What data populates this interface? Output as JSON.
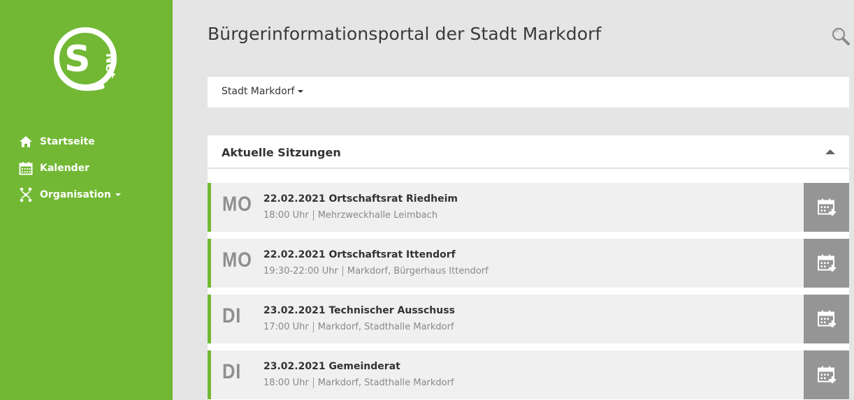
{
  "header": {
    "title": "Bürgerinformationsportal der Stadt Markdorf"
  },
  "logo": {
    "letters": "SNet"
  },
  "sidebar": {
    "items": [
      {
        "label": "Startseite",
        "icon": "home-icon"
      },
      {
        "label": "Kalender",
        "icon": "calendar-icon"
      },
      {
        "label": "Organisation",
        "icon": "organisation-icon",
        "has_dropdown": true
      }
    ]
  },
  "selector": {
    "label": "Stadt Markdorf"
  },
  "panel": {
    "title": "Aktuelle Sitzungen"
  },
  "sessions": [
    {
      "day": "MO",
      "title": "22.02.2021 Ortschaftsrat Riedheim",
      "time": "18:00 Uhr",
      "location": "Mehrzweckhalle Leimbach"
    },
    {
      "day": "MO",
      "title": "22.02.2021 Ortschaftsrat Ittendorf",
      "time": "19:30-22:00 Uhr",
      "location": "Markdorf, Bürgerhaus Ittendorf"
    },
    {
      "day": "DI",
      "title": "23.02.2021 Technischer Ausschuss",
      "time": "17:00 Uhr",
      "location": "Markdorf, Stadthalle Markdorf"
    },
    {
      "day": "DI",
      "title": "23.02.2021 Gemeinderat",
      "time": "18:00 Uhr",
      "location": "Markdorf, Stadthalle Markdorf"
    }
  ],
  "colors": {
    "accent": "#72b834",
    "background": "#e5e5e5",
    "row_bg": "#f0f0f0",
    "day_text": "#8f8f8f",
    "cal_button": "#959595"
  }
}
